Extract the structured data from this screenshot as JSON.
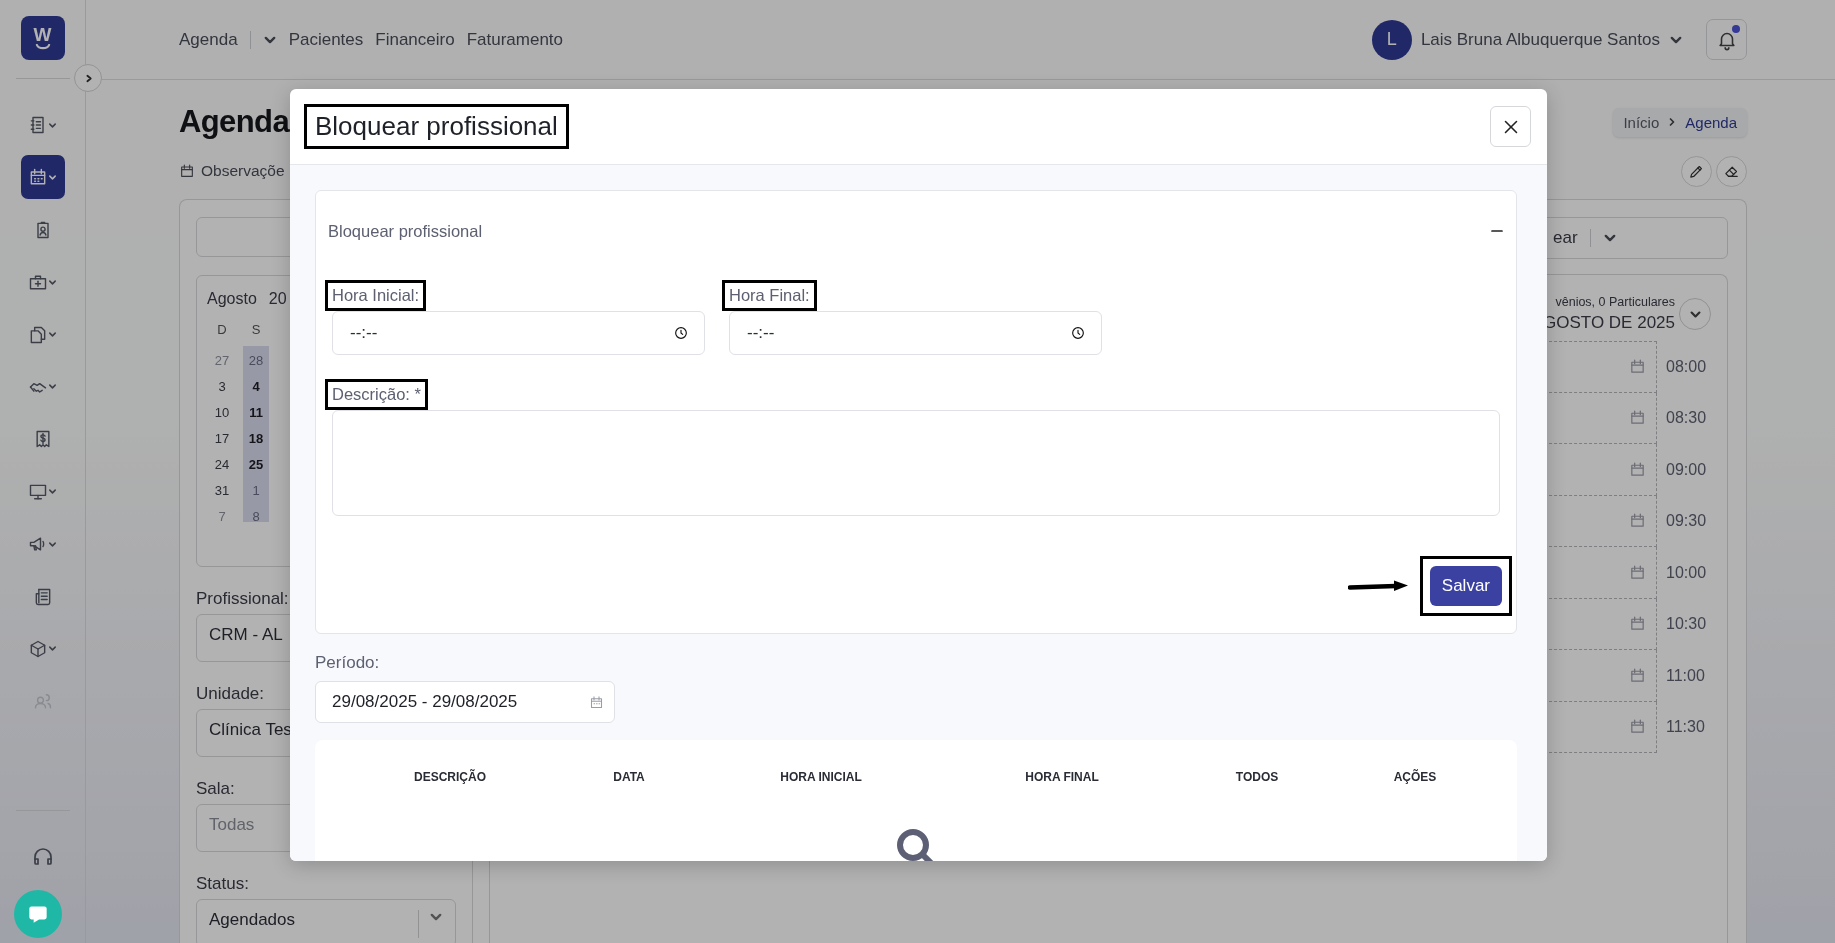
{
  "logo": {
    "letter": "W"
  },
  "sidebar": {
    "items": [
      {
        "selected": false,
        "expandable": true,
        "disabled": false
      },
      {
        "selected": true,
        "expandable": true,
        "disabled": false
      },
      {
        "selected": false,
        "expandable": false,
        "disabled": false
      },
      {
        "selected": false,
        "expandable": true,
        "disabled": false
      },
      {
        "selected": false,
        "expandable": true,
        "disabled": false
      },
      {
        "selected": false,
        "expandable": true,
        "disabled": false
      },
      {
        "selected": false,
        "expandable": false,
        "disabled": false
      },
      {
        "selected": false,
        "expandable": true,
        "disabled": false
      },
      {
        "selected": false,
        "expandable": true,
        "disabled": false
      },
      {
        "selected": false,
        "expandable": false,
        "disabled": false
      },
      {
        "selected": false,
        "expandable": true,
        "disabled": false
      },
      {
        "selected": false,
        "expandable": false,
        "disabled": true
      }
    ]
  },
  "header": {
    "nav": [
      {
        "label": "Agenda",
        "dropdown": true
      },
      {
        "label": "Pacientes"
      },
      {
        "label": "Financeiro"
      },
      {
        "label": "Faturamento"
      }
    ],
    "user": {
      "initial": "L",
      "name": "Lais Bruna Albuquerque Santos"
    },
    "notifications": {
      "unread": true
    }
  },
  "page": {
    "title": "Agenda",
    "subtitle": "Observaçõe",
    "breadcrumb": [
      {
        "label": "Início",
        "selected": false
      },
      {
        "label": "Agenda",
        "selected": true
      }
    ]
  },
  "filters": {
    "calendar": {
      "month": "Agosto",
      "year": "20",
      "columns": [
        {
          "label": "D",
          "highlighted": false
        },
        {
          "label": "S",
          "highlighted": true
        }
      ],
      "weeks": [
        [
          {
            "day": "27",
            "other_month": true
          },
          {
            "day": "28",
            "other_month": true
          }
        ],
        [
          {
            "day": "3",
            "other_month": false
          },
          {
            "day": "4",
            "other_month": false
          }
        ],
        [
          {
            "day": "10",
            "other_month": false
          },
          {
            "day": "11",
            "other_month": false
          }
        ],
        [
          {
            "day": "17",
            "other_month": false
          },
          {
            "day": "18",
            "other_month": false
          }
        ],
        [
          {
            "day": "24",
            "other_month": false
          },
          {
            "day": "25",
            "other_month": false
          }
        ],
        [
          {
            "day": "31",
            "other_month": false
          },
          {
            "day": "1",
            "other_month": true
          }
        ],
        [
          {
            "day": "7",
            "other_month": true
          },
          {
            "day": "8",
            "other_month": true
          }
        ]
      ]
    },
    "fields": [
      {
        "label": "Profissional:",
        "value": "CRM - AL"
      },
      {
        "label": "Unidade:",
        "value": "Clínica Tes"
      },
      {
        "label": "Sala:",
        "placeholder": "Todas"
      },
      {
        "label": "Status:",
        "value": "Agendados",
        "dropdown": true
      }
    ]
  },
  "schedule": {
    "view_select": "ear",
    "summary": "vênios, 0 Particulares",
    "date": "GOSTO DE 2025",
    "slots": [
      {
        "time": "08:00"
      },
      {
        "time": "08:30"
      },
      {
        "time": "09:00"
      },
      {
        "time": "09:30"
      },
      {
        "time": "10:00"
      },
      {
        "time": "10:30"
      },
      {
        "time": "11:00"
      },
      {
        "time": "11:30"
      }
    ]
  },
  "modal": {
    "title": "Bloquear profissional",
    "title_highlighted": true,
    "section": {
      "title": "Bloquear profissional",
      "expanded": true,
      "fields": [
        {
          "kind": "time",
          "label": "Hora Inicial:",
          "placeholder": "--:--",
          "highlighted": true
        },
        {
          "kind": "time",
          "label": "Hora Final:",
          "placeholder": "--:--",
          "highlighted": true
        },
        {
          "kind": "textarea",
          "label": "Descrição: *",
          "highlighted": true
        }
      ],
      "save_button": {
        "label": "Salvar",
        "highlighted": true,
        "arrow": true
      }
    },
    "period": {
      "label": "Período:",
      "value": "29/08/2025 - 29/08/2025"
    },
    "table": {
      "columns": [
        "DESCRIÇÃO",
        "DATA",
        "HORA INICIAL",
        "HORA FINAL",
        "TODOS",
        "AÇÕES"
      ],
      "empty": true
    }
  }
}
